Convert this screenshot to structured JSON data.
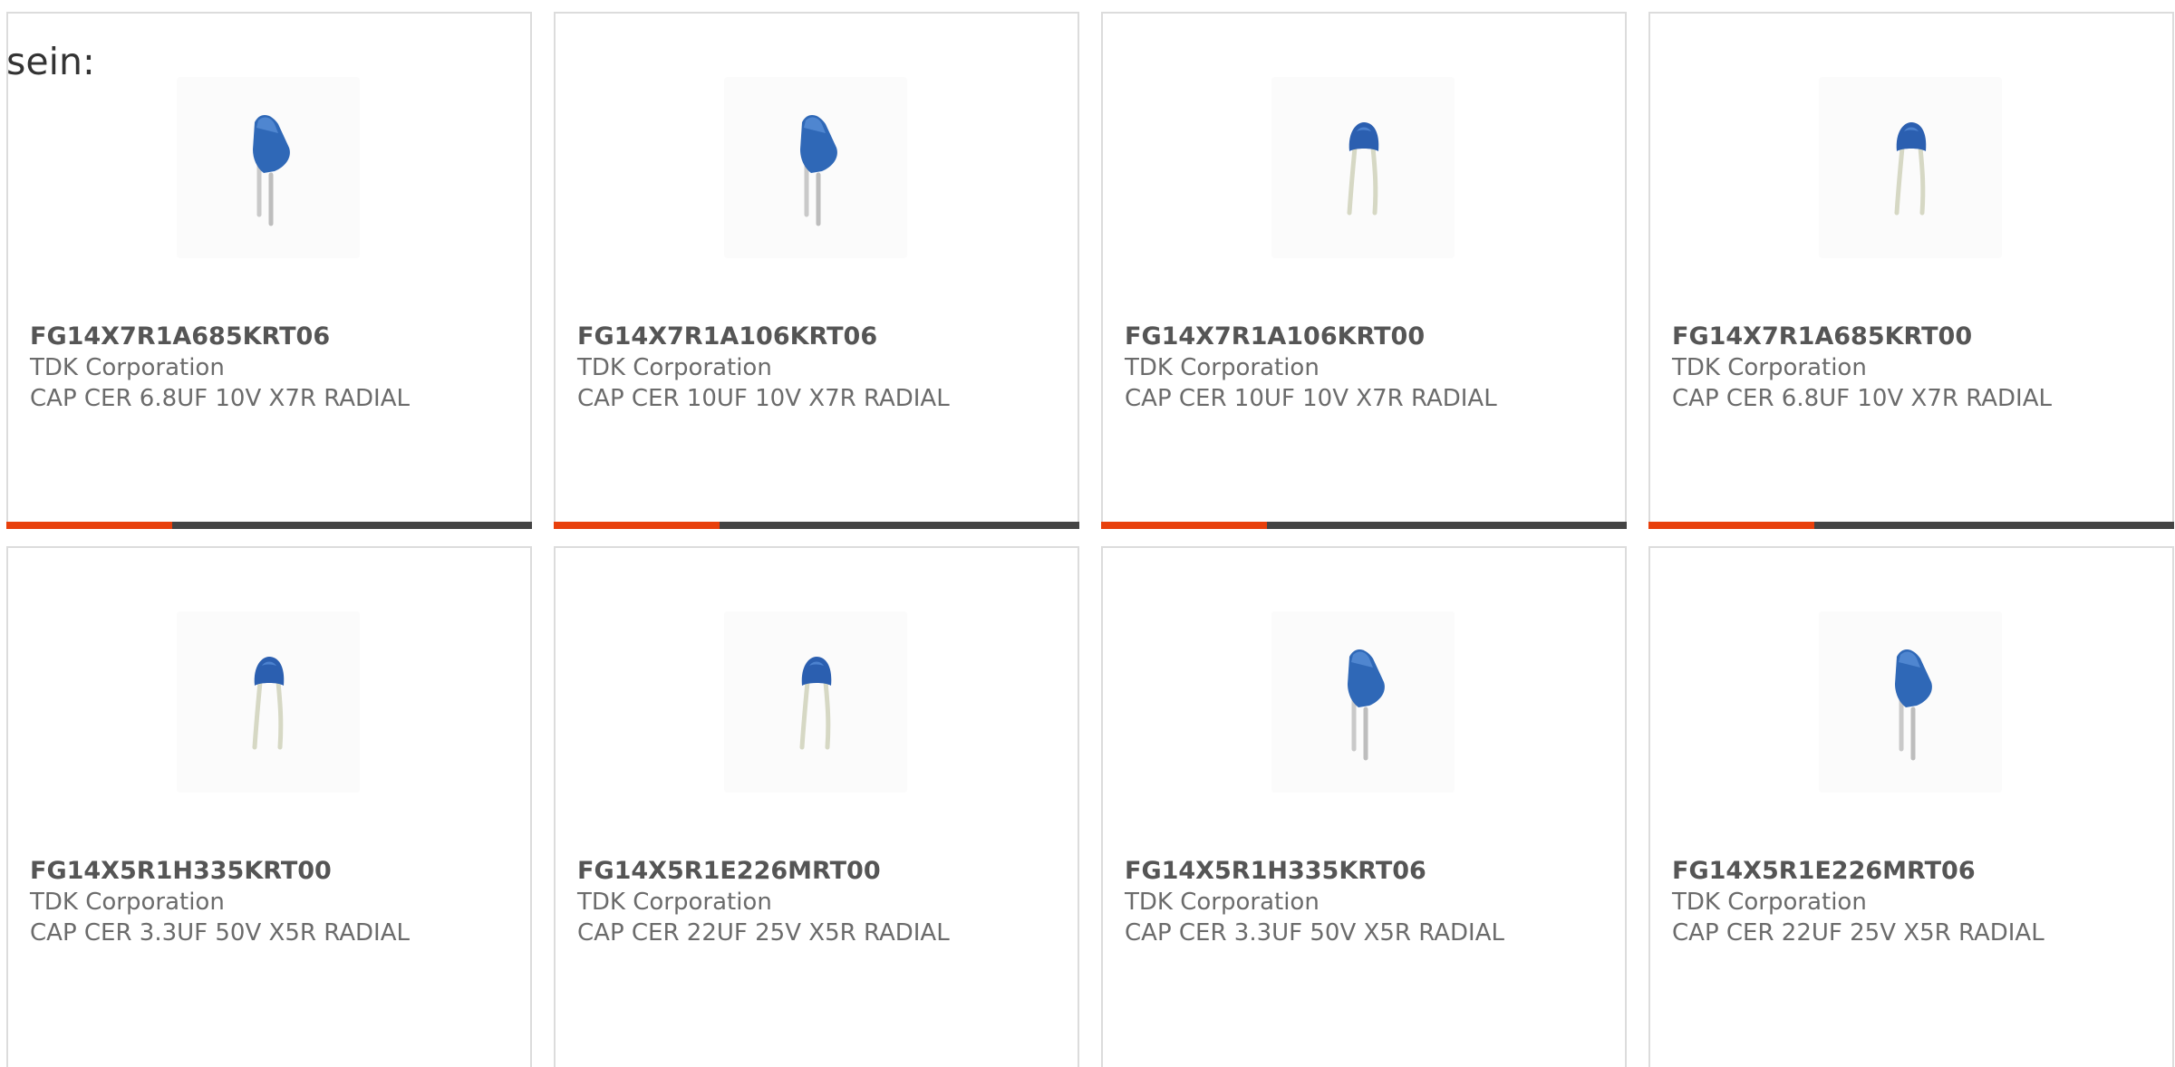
{
  "intro_text": "sein:",
  "accent_color": "#e8400c",
  "track_color": "#444444",
  "products": [
    {
      "part_number": "FG14X7R1A685KRT06",
      "manufacturer": "TDK Corporation",
      "description": "CAP CER 6.8UF 10V X7R RADIAL",
      "image_icon": "capacitor-side-view-icon",
      "progress_fraction": 0.315
    },
    {
      "part_number": "FG14X7R1A106KRT06",
      "manufacturer": "TDK Corporation",
      "description": "CAP CER 10UF 10V X7R RADIAL",
      "image_icon": "capacitor-side-view-icon",
      "progress_fraction": 0.315
    },
    {
      "part_number": "FG14X7R1A106KRT00",
      "manufacturer": "TDK Corporation",
      "description": "CAP CER 10UF 10V X7R RADIAL",
      "image_icon": "capacitor-front-view-icon",
      "progress_fraction": 0.315
    },
    {
      "part_number": "FG14X7R1A685KRT00",
      "manufacturer": "TDK Corporation",
      "description": "CAP CER 6.8UF 10V X7R RADIAL",
      "image_icon": "capacitor-front-view-icon",
      "progress_fraction": 0.315
    },
    {
      "part_number": "FG14X5R1H335KRT00",
      "manufacturer": "TDK Corporation",
      "description": "CAP CER 3.3UF 50V X5R RADIAL",
      "image_icon": "capacitor-front-view-icon"
    },
    {
      "part_number": "FG14X5R1E226MRT00",
      "manufacturer": "TDK Corporation",
      "description": "CAP CER 22UF 25V X5R RADIAL",
      "image_icon": "capacitor-front-view-icon"
    },
    {
      "part_number": "FG14X5R1H335KRT06",
      "manufacturer": "TDK Corporation",
      "description": "CAP CER 3.3UF 50V X5R RADIAL",
      "image_icon": "capacitor-side-view-icon"
    },
    {
      "part_number": "FG14X5R1E226MRT06",
      "manufacturer": "TDK Corporation",
      "description": "CAP CER 22UF 25V X5R RADIAL",
      "image_icon": "capacitor-side-view-icon"
    }
  ]
}
